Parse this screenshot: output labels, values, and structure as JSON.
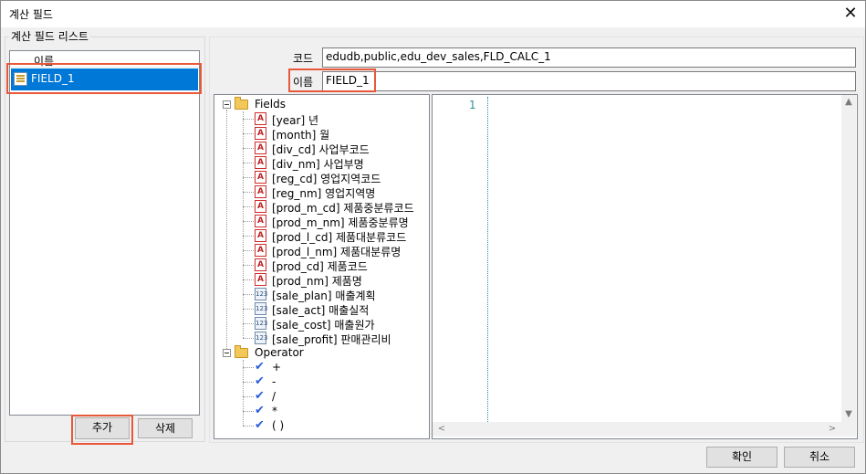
{
  "window": {
    "title": "계산 필드",
    "close_glyph": "✕"
  },
  "field_list": {
    "group_label": "계산 필드 리스트",
    "column_header": "이름",
    "items": [
      {
        "label": "FIELD_1",
        "selected": true,
        "icon": "table-icon"
      }
    ],
    "add_button": "추가",
    "delete_button": "삭제"
  },
  "form": {
    "code_label": "코드",
    "code_value": "edudb,public,edu_dev_sales,FLD_CALC_1",
    "name_label": "이름",
    "name_value": "FIELD_1"
  },
  "tree": {
    "fields_label": "Fields",
    "fields": [
      {
        "label": "[year] 년",
        "type": "text"
      },
      {
        "label": "[month] 월",
        "type": "text"
      },
      {
        "label": "[div_cd] 사업부코드",
        "type": "text"
      },
      {
        "label": "[div_nm] 사업부명",
        "type": "text"
      },
      {
        "label": "[reg_cd] 영업지역코드",
        "type": "text"
      },
      {
        "label": "[reg_nm] 영업지역명",
        "type": "text"
      },
      {
        "label": "[prod_m_cd] 제품중분류코드",
        "type": "text"
      },
      {
        "label": "[prod_m_nm] 제품중분류명",
        "type": "text"
      },
      {
        "label": "[prod_l_cd] 제품대분류코드",
        "type": "text"
      },
      {
        "label": "[prod_l_nm] 제품대분류명",
        "type": "text"
      },
      {
        "label": "[prod_cd] 제품코드",
        "type": "text"
      },
      {
        "label": "[prod_nm] 제품명",
        "type": "text"
      },
      {
        "label": "[sale_plan] 매출계획",
        "type": "number"
      },
      {
        "label": "[sale_act] 매출실적",
        "type": "number"
      },
      {
        "label": "[sale_cost] 매출원가",
        "type": "number"
      },
      {
        "label": "[sale_profit] 판매관리비",
        "type": "number"
      }
    ],
    "operator_label": "Operator",
    "operators": [
      "+",
      "-",
      "/",
      "*",
      "( )"
    ],
    "text_icon_glyph": "A",
    "number_icon_glyph": "123"
  },
  "editor": {
    "line_number": "1",
    "scroll_up": "▲",
    "scroll_down": "▼",
    "scroll_left": "<",
    "scroll_right": ">"
  },
  "footer": {
    "ok_button": "확인",
    "cancel_button": "취소"
  },
  "colors": {
    "selection": "#0078d7",
    "highlight_box": "#e8583a",
    "gutter": "#2a8f93"
  }
}
